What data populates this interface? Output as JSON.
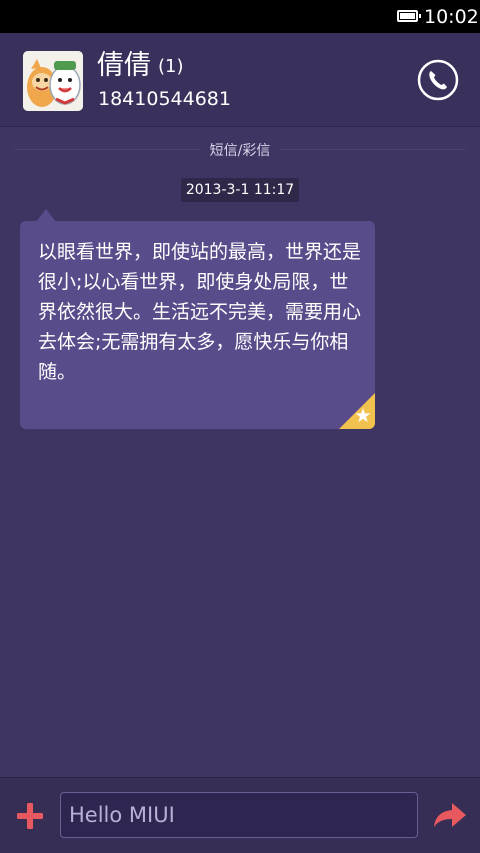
{
  "status_bar": {
    "time": "10:02",
    "battery_icon": "battery-full-icon"
  },
  "header": {
    "contact_name": "倩倩",
    "unread_count": "(1)",
    "phone_number": "18410544681",
    "call_icon": "phone-icon"
  },
  "conversation": {
    "channel_label": "短信/彩信",
    "timestamp": "2013-3-1 11:17",
    "messages": [
      {
        "text": "以眼看世界，即使站的最高，世界还是很小;以心看世界，即使身处局限，世界依然很大。生活远不完美，需要用心去体会;无需拥有太多，愿快乐与你相随。",
        "starred": true
      }
    ]
  },
  "composer": {
    "add_icon": "plus-icon",
    "placeholder": "Hello MIUI",
    "send_icon": "send-arrow-icon"
  },
  "colors": {
    "background": "#3f3562",
    "header": "#3a305c",
    "bubble": "#5a4c8a",
    "accent_red": "#e8585f",
    "star_gold": "#f2c24e"
  }
}
